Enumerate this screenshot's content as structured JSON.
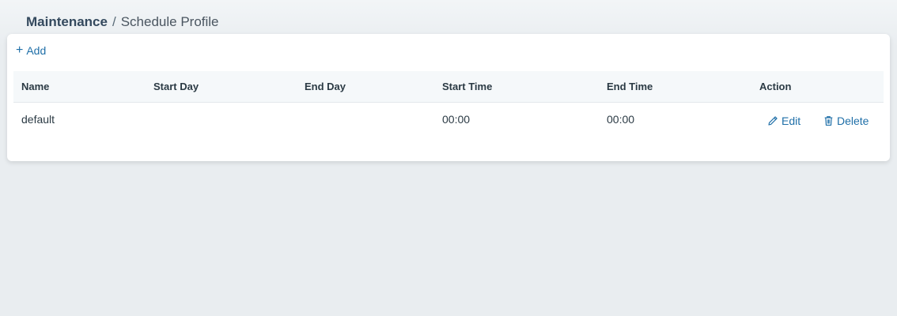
{
  "breadcrumb": {
    "root": "Maintenance",
    "separator": "/",
    "current": "Schedule Profile"
  },
  "toolbar": {
    "add_label": "Add",
    "add_icon": "plus-icon"
  },
  "table": {
    "columns": [
      "Name",
      "Start Day",
      "End Day",
      "Start Time",
      "End Time",
      "Action"
    ],
    "rows": [
      {
        "name": "default",
        "start_day": "",
        "end_day": "",
        "start_time": "00:00",
        "end_time": "00:00",
        "edit_label": "Edit",
        "delete_label": "Delete"
      }
    ]
  },
  "icons": {
    "edit": "pencil-icon",
    "delete": "trash-icon"
  },
  "colors": {
    "accent": "#1f6fa8",
    "background": "#e9edf0",
    "header_bg": "#f5f8fa"
  }
}
